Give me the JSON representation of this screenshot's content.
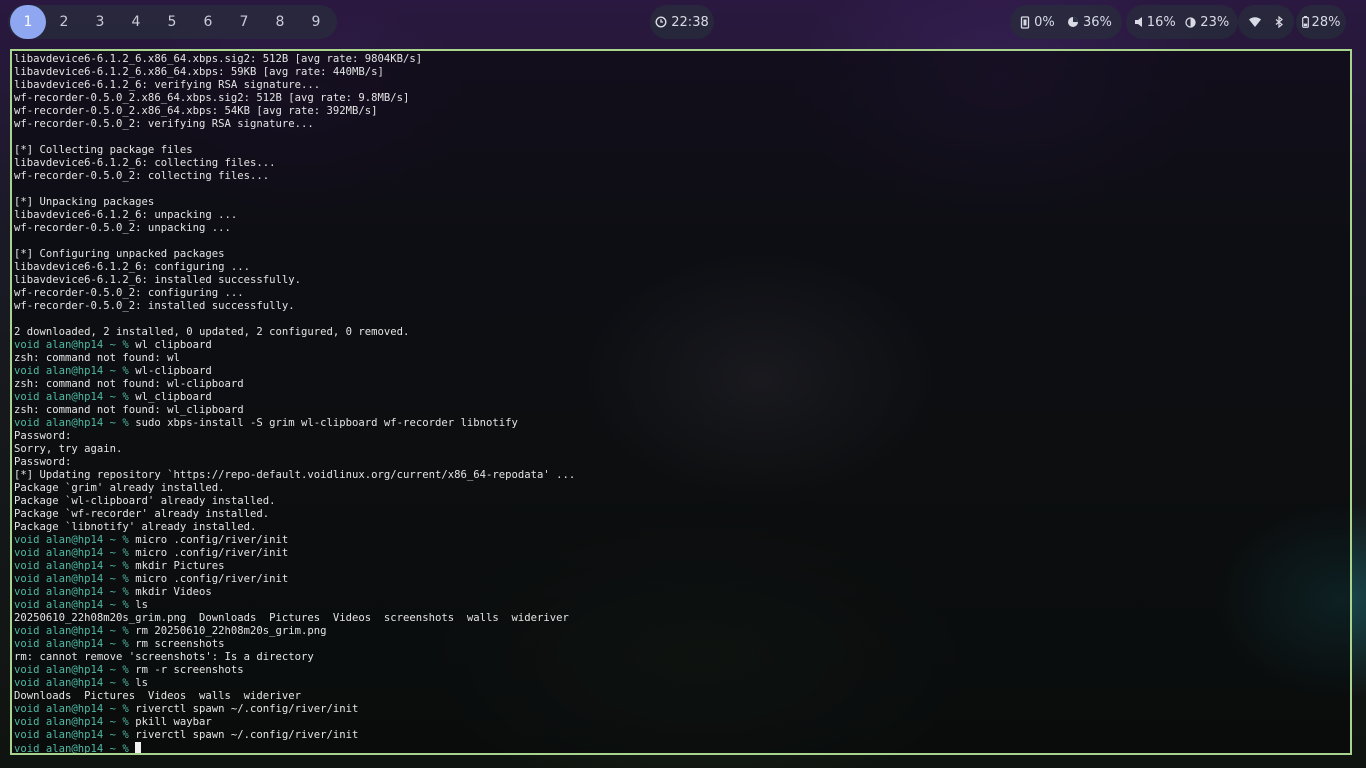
{
  "topbar": {
    "workspaces": [
      "1",
      "2",
      "3",
      "4",
      "5",
      "6",
      "7",
      "8",
      "9"
    ],
    "active_workspace": "1",
    "clock": {
      "icon": "clock-icon",
      "time": "22:38"
    },
    "cpu": {
      "icon": "cpu-icon",
      "value": "0%"
    },
    "memory": {
      "icon": "memory-pie-icon",
      "value": "36%"
    },
    "volume": {
      "icon": "speaker-icon",
      "value": "16%"
    },
    "brightness": {
      "icon": "brightness-icon",
      "value": "23%"
    },
    "network": {
      "icon": "wifi-icon"
    },
    "bluetooth": {
      "icon": "bluetooth-icon"
    },
    "battery": {
      "icon": "battery-icon",
      "value": "28%"
    }
  },
  "terminal": {
    "border_color": "#a9d48e",
    "prompt_color": "#4fb8a2",
    "lines": [
      {
        "text": "libavdevice6-6.1.2_6.x86_64.xbps.sig2: 512B [avg rate: 9804KB/s]"
      },
      {
        "text": "libavdevice6-6.1.2_6.x86_64.xbps: 59KB [avg rate: 440MB/s]"
      },
      {
        "text": "libavdevice6-6.1.2_6: verifying RSA signature..."
      },
      {
        "text": "wf-recorder-0.5.0_2.x86_64.xbps.sig2: 512B [avg rate: 9.8MB/s]"
      },
      {
        "text": "wf-recorder-0.5.0_2.x86_64.xbps: 54KB [avg rate: 392MB/s]"
      },
      {
        "text": "wf-recorder-0.5.0_2: verifying RSA signature..."
      },
      {
        "text": ""
      },
      {
        "text": "[*] Collecting package files"
      },
      {
        "text": "libavdevice6-6.1.2_6: collecting files..."
      },
      {
        "text": "wf-recorder-0.5.0_2: collecting files..."
      },
      {
        "text": ""
      },
      {
        "text": "[*] Unpacking packages"
      },
      {
        "text": "libavdevice6-6.1.2_6: unpacking ..."
      },
      {
        "text": "wf-recorder-0.5.0_2: unpacking ..."
      },
      {
        "text": ""
      },
      {
        "text": "[*] Configuring unpacked packages"
      },
      {
        "text": "libavdevice6-6.1.2_6: configuring ..."
      },
      {
        "text": "libavdevice6-6.1.2_6: installed successfully."
      },
      {
        "text": "wf-recorder-0.5.0_2: configuring ..."
      },
      {
        "text": "wf-recorder-0.5.0_2: installed successfully."
      },
      {
        "text": ""
      },
      {
        "text": "2 downloaded, 2 installed, 0 updated, 2 configured, 0 removed."
      },
      {
        "prompt": "void alan@hp14 ~ % ",
        "text": "wl clipboard"
      },
      {
        "text": "zsh: command not found: wl"
      },
      {
        "prompt": "void alan@hp14 ~ % ",
        "text": "wl-clipboard"
      },
      {
        "text": "zsh: command not found: wl-clipboard"
      },
      {
        "prompt": "void alan@hp14 ~ % ",
        "text": "wl_clipboard"
      },
      {
        "text": "zsh: command not found: wl_clipboard"
      },
      {
        "prompt": "void alan@hp14 ~ % ",
        "text": "sudo xbps-install -S grim wl-clipboard wf-recorder libnotify"
      },
      {
        "text": "Password:"
      },
      {
        "text": "Sorry, try again."
      },
      {
        "text": "Password:"
      },
      {
        "text": "[*] Updating repository `https://repo-default.voidlinux.org/current/x86_64-repodata' ..."
      },
      {
        "text": "Package `grim' already installed."
      },
      {
        "text": "Package `wl-clipboard' already installed."
      },
      {
        "text": "Package `wf-recorder' already installed."
      },
      {
        "text": "Package `libnotify' already installed."
      },
      {
        "prompt": "void alan@hp14 ~ % ",
        "text": "micro .config/river/init"
      },
      {
        "prompt": "void alan@hp14 ~ % ",
        "text": "micro .config/river/init"
      },
      {
        "prompt": "void alan@hp14 ~ % ",
        "text": "mkdir Pictures"
      },
      {
        "prompt": "void alan@hp14 ~ % ",
        "text": "micro .config/river/init"
      },
      {
        "prompt": "void alan@hp14 ~ % ",
        "text": "mkdir Videos"
      },
      {
        "prompt": "void alan@hp14 ~ % ",
        "text": "ls"
      },
      {
        "text": "20250610_22h08m20s_grim.png  Downloads  Pictures  Videos  screenshots  walls  wideriver"
      },
      {
        "prompt": "void alan@hp14 ~ % ",
        "text": "rm 20250610_22h08m20s_grim.png"
      },
      {
        "prompt": "void alan@hp14 ~ % ",
        "text": "rm screenshots"
      },
      {
        "text": "rm: cannot remove 'screenshots': Is a directory"
      },
      {
        "prompt": "void alan@hp14 ~ % ",
        "text": "rm -r screenshots"
      },
      {
        "prompt": "void alan@hp14 ~ % ",
        "text": "ls"
      },
      {
        "text": "Downloads  Pictures  Videos  walls  wideriver"
      },
      {
        "prompt": "void alan@hp14 ~ % ",
        "text": "riverctl spawn ~/.config/river/init"
      },
      {
        "prompt": "void alan@hp14 ~ % ",
        "text": "pkill waybar"
      },
      {
        "prompt": "void alan@hp14 ~ % ",
        "text": "riverctl spawn ~/.config/river/init"
      },
      {
        "prompt": "void alan@hp14 ~ % ",
        "text": "",
        "cursor": true
      }
    ]
  }
}
